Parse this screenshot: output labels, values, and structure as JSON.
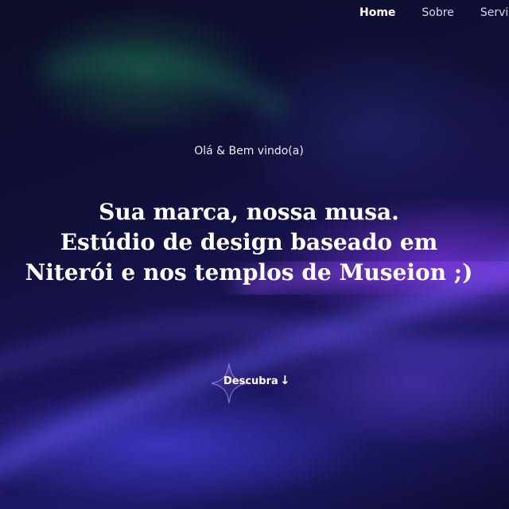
{
  "nav": {
    "items": [
      {
        "label": "Home",
        "active": true
      },
      {
        "label": "Sobre",
        "active": false
      },
      {
        "label": "Servi",
        "active": false
      }
    ]
  },
  "hero": {
    "greeting": "Olá & Bem vindo(a)",
    "headline_lines": [
      "Sua marca, nossa musa.",
      "Estúdio de design baseado em",
      "Niterói e nos templos de Museion ;)"
    ],
    "cta": {
      "label": "Descubra",
      "icon": "arrow-down-icon",
      "decoration": "sparkle-star-icon"
    }
  },
  "colors": {
    "text": "#ffffff",
    "background_dark": "#0b0b1f",
    "accent_purple": "#7a3ce0",
    "accent_blue": "#4a40e0"
  }
}
